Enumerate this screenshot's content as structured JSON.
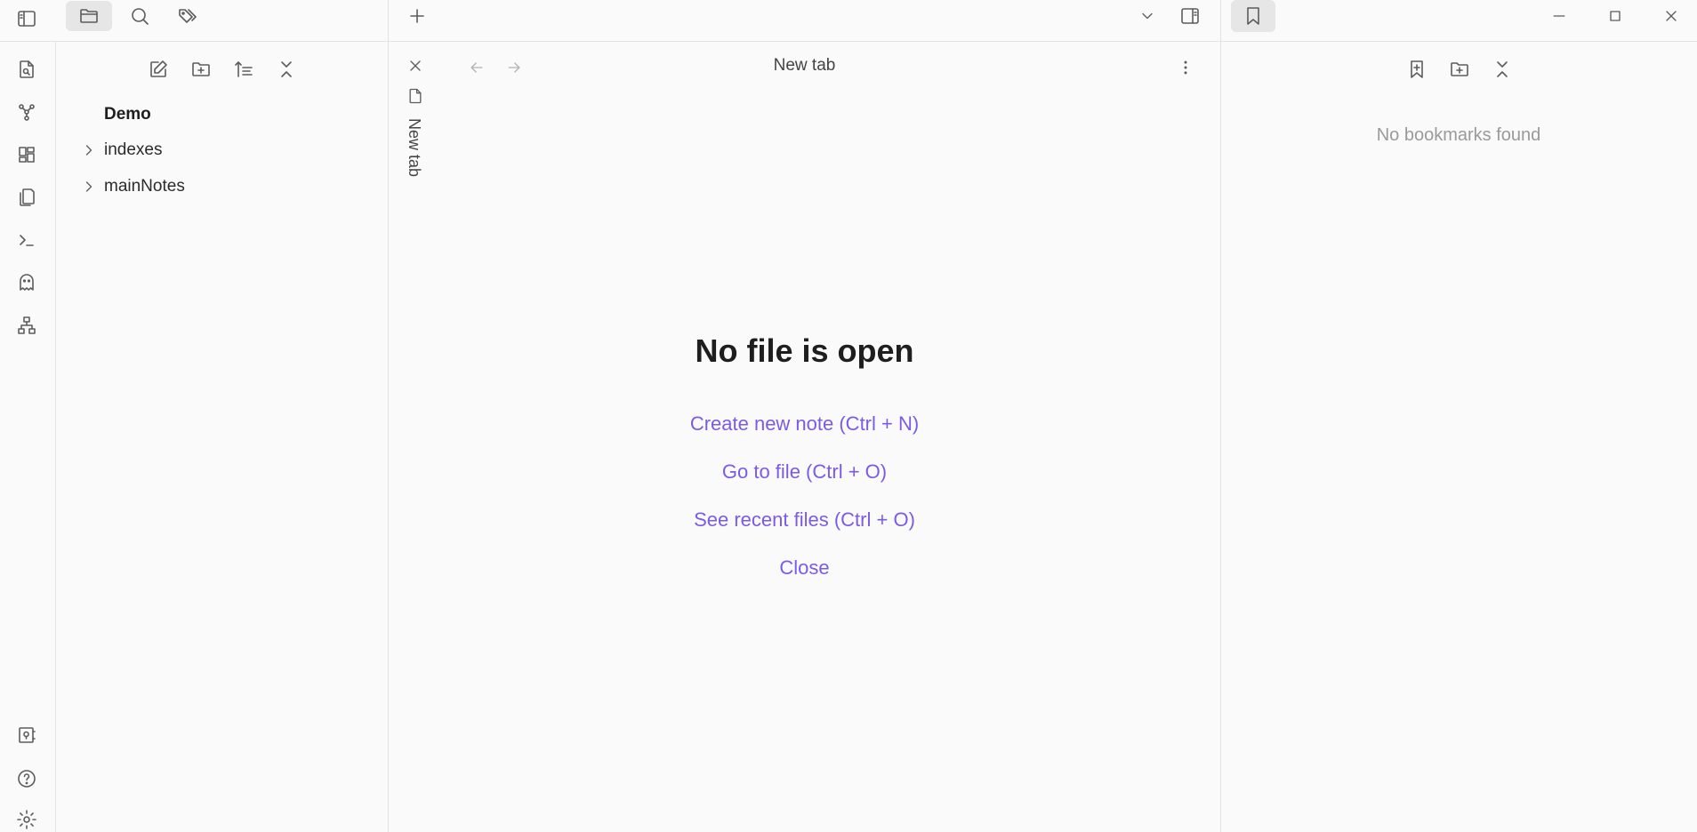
{
  "top_left_icons": [
    {
      "name": "toggle-left-sidebar-icon"
    },
    {
      "name": "files-icon"
    },
    {
      "name": "search-icon"
    },
    {
      "name": "tags-icon"
    }
  ],
  "file_explorer": {
    "toolbar": [
      "new-note-icon",
      "new-folder-icon",
      "sort-icon",
      "collapse-all-icon"
    ],
    "vault_name": "Demo",
    "folders": [
      "indexes",
      "mainNotes"
    ]
  },
  "editor": {
    "vertical_tab_label": "New tab",
    "tab_title": "New tab",
    "empty_state": {
      "title": "No file is open",
      "actions": [
        "Create new note (Ctrl + N)",
        "Go to file (Ctrl + O)",
        "See recent files (Ctrl + O)",
        "Close"
      ]
    }
  },
  "bookmarks": {
    "empty_text": "No bookmarks found"
  },
  "ribbon": [
    "open-quick-switcher-icon",
    "graph-view-icon",
    "canvas-icon",
    "templates-icon",
    "command-palette-icon",
    "ghost-icon",
    "sitemap-icon"
  ],
  "ribbon_bottom": [
    "vault-icon",
    "help-icon",
    "settings-icon"
  ],
  "colors": {
    "accent": "#7b5be6",
    "background": "#fafafa",
    "border": "#e3e3e3"
  }
}
